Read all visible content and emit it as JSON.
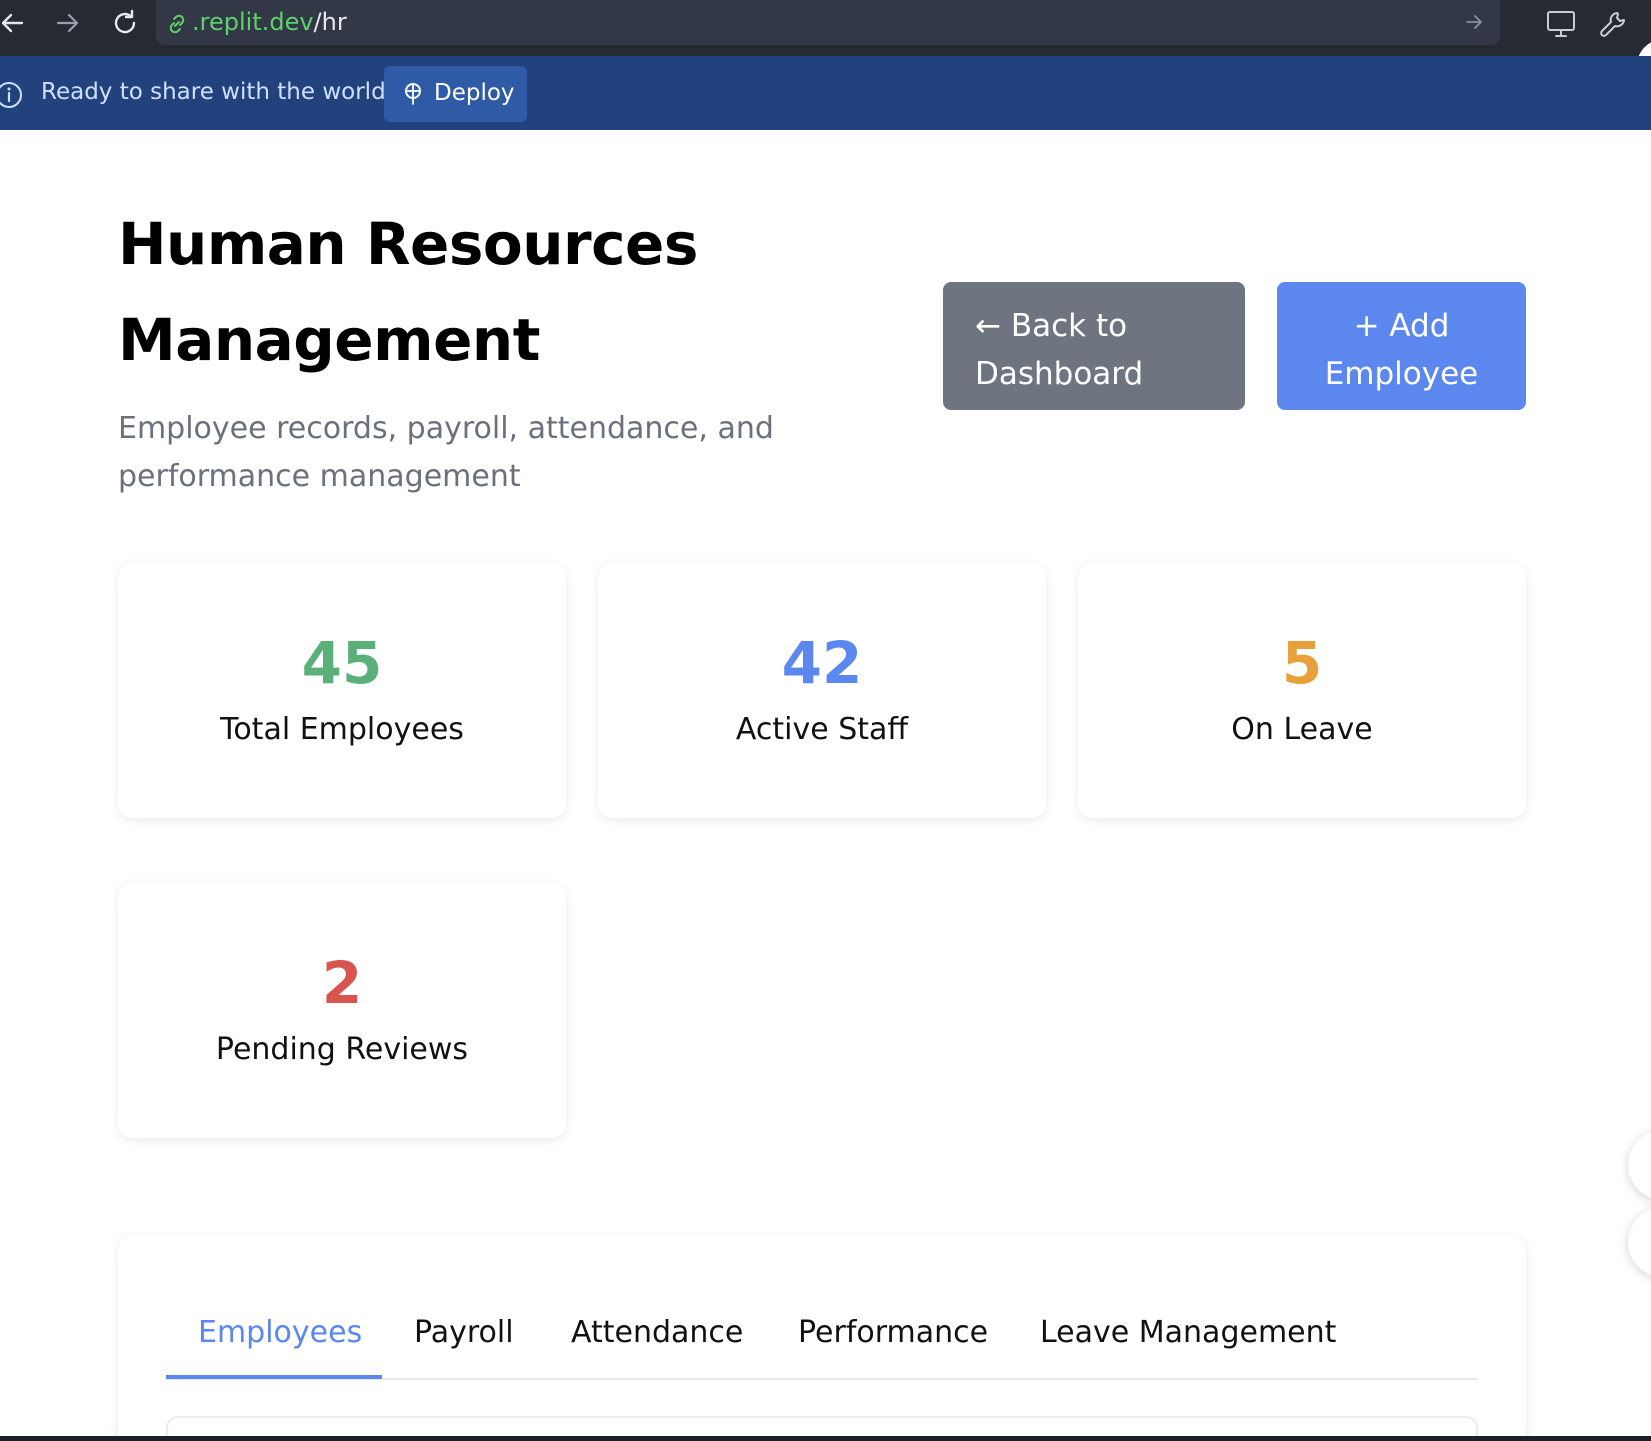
{
  "browser": {
    "url_host": ".replit.dev",
    "url_path": "/hr"
  },
  "banner": {
    "message": "Ready to share with the world?",
    "deploy_label": "Deploy"
  },
  "header": {
    "title": "Human Resources Management",
    "subtitle": "Employee records, payroll, attendance, and performance management",
    "back_button": "← Back to Dashboard",
    "add_button": "+ Add Employee"
  },
  "stats": [
    {
      "value": "45",
      "label": "Total Employees",
      "color": "#5bb07a"
    },
    {
      "value": "42",
      "label": "Active Staff",
      "color": "#5b87ef"
    },
    {
      "value": "5",
      "label": "On Leave",
      "color": "#e8a13a"
    },
    {
      "value": "2",
      "label": "Pending Reviews",
      "color": "#d9534f"
    }
  ],
  "tabs": [
    {
      "label": "Employees",
      "active": true
    },
    {
      "label": "Payroll",
      "active": false
    },
    {
      "label": "Attendance",
      "active": false
    },
    {
      "label": "Performance",
      "active": false
    },
    {
      "label": "Leave Management",
      "active": false
    }
  ],
  "colors": {
    "accent": "#5b87ef",
    "banner": "#22427e",
    "browser_bar": "#252a33"
  },
  "icons": {
    "back": "arrow-left-icon",
    "forward": "arrow-right-icon",
    "reload": "reload-icon",
    "link": "link-icon",
    "url_go": "arrow-right-icon",
    "devices": "monitor-icon",
    "tools": "wrench-icon",
    "info": "info-icon",
    "deploy": "deploy-icon"
  }
}
